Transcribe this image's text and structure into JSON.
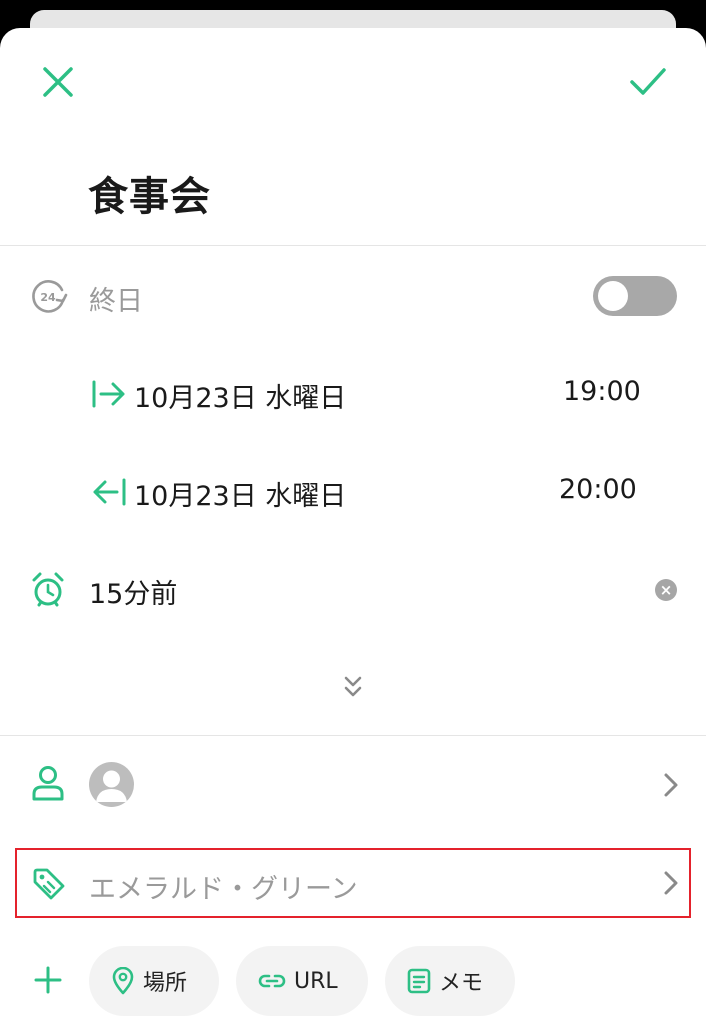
{
  "event": {
    "title": "食事会"
  },
  "all_day": {
    "label": "終日",
    "enabled": false
  },
  "start": {
    "date": "10月23日 水曜日",
    "time": "19:00"
  },
  "end": {
    "date": "10月23日 水曜日",
    "time": "20:00"
  },
  "reminder": {
    "label": "15分前"
  },
  "color": {
    "label": "エメラルド・グリーン"
  },
  "chips": {
    "location": "場所",
    "url": "URL",
    "memo": "メモ"
  },
  "colors": {
    "accent": "#2dbf85",
    "highlight_border": "#e4222c",
    "toggle_off": "#a8a8a8"
  },
  "icons": [
    "close-icon",
    "check-icon",
    "all-day-24h-icon",
    "start-arrow-icon",
    "end-arrow-icon",
    "alarm-icon",
    "clear-icon",
    "expand-double-chevron-icon",
    "person-icon",
    "avatar",
    "chevron-right-icon",
    "tag-icon",
    "add-icon",
    "location-pin-icon",
    "link-icon",
    "note-icon"
  ]
}
